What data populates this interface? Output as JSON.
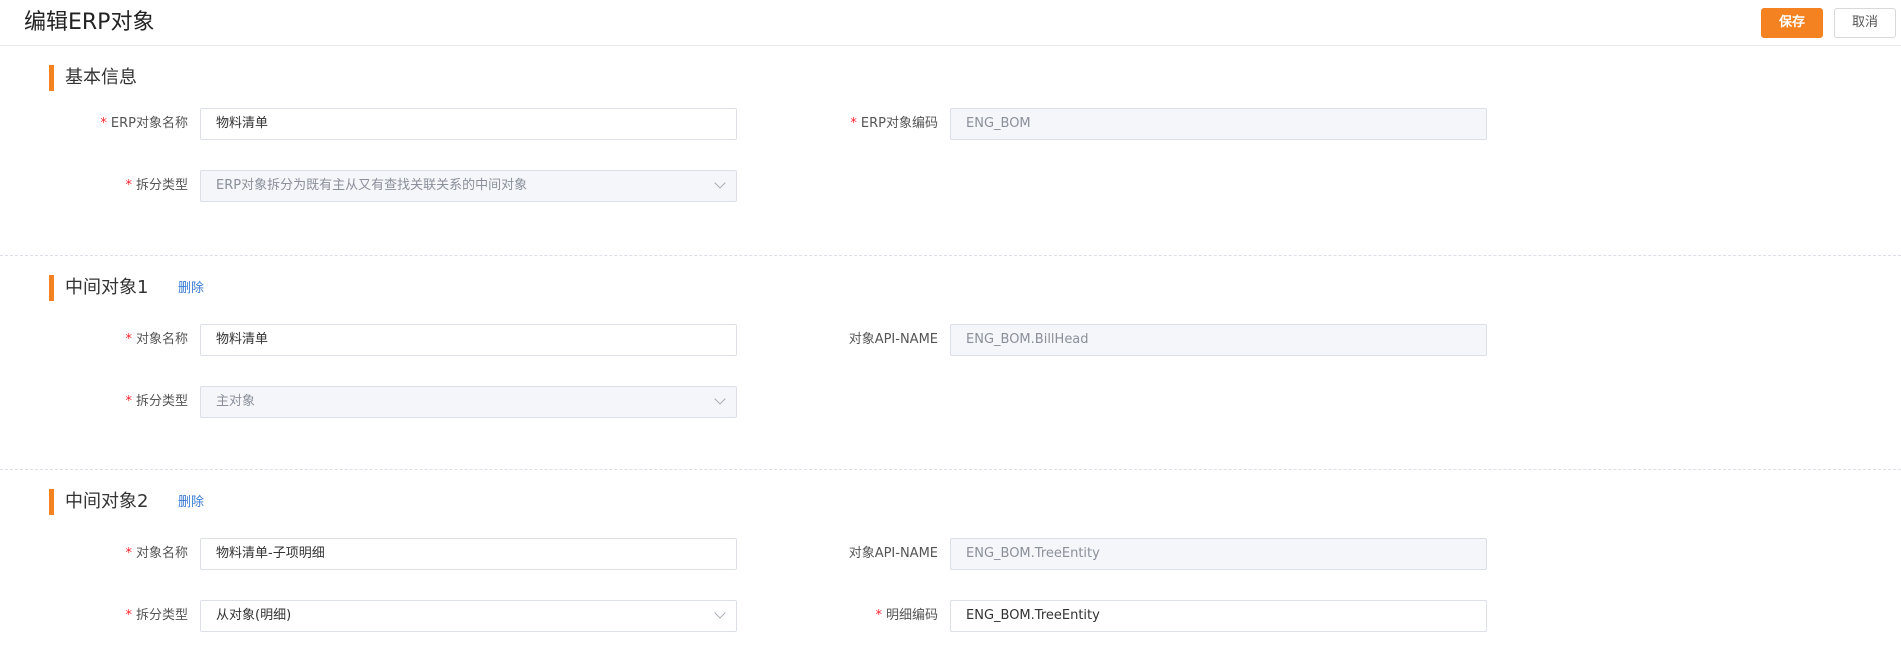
{
  "header": {
    "title": "编辑ERP对象",
    "save_label": "保存",
    "cancel_label": "取消"
  },
  "colors": {
    "accent": "#f58220",
    "link": "#3a7bd5",
    "required": "#f5222d"
  },
  "sections": [
    {
      "title": "基本信息",
      "rows": [
        {
          "left": {
            "label": "ERP对象名称",
            "required": true,
            "value": "物料清单",
            "state": "active",
            "type": "input"
          },
          "right": {
            "label": "ERP对象编码",
            "required": true,
            "value": "ENG_BOM",
            "state": "disabled",
            "type": "input"
          }
        },
        {
          "left": {
            "label": "拆分类型",
            "required": true,
            "value": "ERP对象拆分为既有主从又有查找关联关系的中间对象",
            "state": "disabled",
            "type": "select"
          }
        }
      ]
    },
    {
      "title": "中间对象1",
      "link": "删除",
      "rows": [
        {
          "left": {
            "label": "对象名称",
            "required": true,
            "value": "物料清单",
            "state": "active",
            "type": "input"
          },
          "right": {
            "label": "对象API-NAME",
            "required": false,
            "value": "ENG_BOM.BillHead",
            "state": "disabled",
            "type": "input"
          }
        },
        {
          "left": {
            "label": "拆分类型",
            "required": true,
            "value": "主对象",
            "state": "disabled",
            "type": "select"
          }
        }
      ]
    },
    {
      "title": "中间对象2",
      "link": "删除",
      "rows": [
        {
          "left": {
            "label": "对象名称",
            "required": true,
            "value": "物料清单-子项明细",
            "state": "active",
            "type": "input"
          },
          "right": {
            "label": "对象API-NAME",
            "required": false,
            "value": "ENG_BOM.TreeEntity",
            "state": "disabled",
            "type": "input"
          }
        },
        {
          "left": {
            "label": "拆分类型",
            "required": true,
            "value": "从对象(明细)",
            "state": "active",
            "type": "select"
          },
          "right": {
            "label": "明细编码",
            "required": true,
            "value": "ENG_BOM.TreeEntity",
            "state": "active",
            "type": "input"
          }
        }
      ]
    }
  ]
}
